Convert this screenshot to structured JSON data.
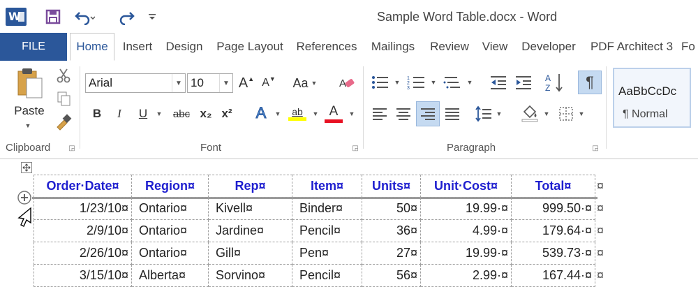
{
  "window": {
    "title": "Sample Word Table.docx - Word",
    "app_icon_letter": "W"
  },
  "tabs": [
    {
      "label": "FILE"
    },
    {
      "label": "Home"
    },
    {
      "label": "Insert"
    },
    {
      "label": "Design"
    },
    {
      "label": "Page Layout"
    },
    {
      "label": "References"
    },
    {
      "label": "Mailings"
    },
    {
      "label": "Review"
    },
    {
      "label": "View"
    },
    {
      "label": "Developer"
    },
    {
      "label": "PDF Architect 3"
    },
    {
      "label": "Fo"
    }
  ],
  "ribbon": {
    "clipboard": {
      "label": "Clipboard",
      "paste_label": "Paste"
    },
    "font": {
      "label": "Font",
      "font_name": "Arial",
      "font_size": "10",
      "case_label": "Aa",
      "bold": "B",
      "italic": "I",
      "underline": "U",
      "strike": "abc",
      "subscript": "x₂",
      "superscript": "x²",
      "grow": "A",
      "shrink": "A",
      "text_effects": "A",
      "highlight": "ab",
      "font_color": "A"
    },
    "paragraph": {
      "label": "Paragraph",
      "pilcrow": "¶"
    },
    "styles": {
      "preview": "AaBbCcDc",
      "name": "¶ Normal"
    }
  },
  "colors": {
    "accent": "#2b579a",
    "header_text": "#1f1fcf",
    "highlight_yellow": "#ffff00",
    "font_red": "#e81123"
  },
  "table": {
    "headers": [
      "Order·Date¤",
      "Region¤",
      "Rep¤",
      "Item¤",
      "Units¤",
      "Unit·Cost¤",
      "Total¤"
    ],
    "rows": [
      [
        "1/23/10¤",
        "Ontario¤",
        "Kivell¤",
        "Binder¤",
        "50¤",
        "19.99·¤",
        "999.50·¤"
      ],
      [
        "2/9/10¤",
        "Ontario¤",
        "Jardine¤",
        "Pencil¤",
        "36¤",
        "4.99·¤",
        "179.64·¤"
      ],
      [
        "2/26/10¤",
        "Ontario¤",
        "Gill¤",
        "Pen¤",
        "27¤",
        "19.99·¤",
        "539.73·¤"
      ],
      [
        "3/15/10¤",
        "Alberta¤",
        "Sorvino¤",
        "Pencil¤",
        "56¤",
        "2.99·¤",
        "167.44·¤"
      ]
    ],
    "row_end_mark": "¤"
  }
}
